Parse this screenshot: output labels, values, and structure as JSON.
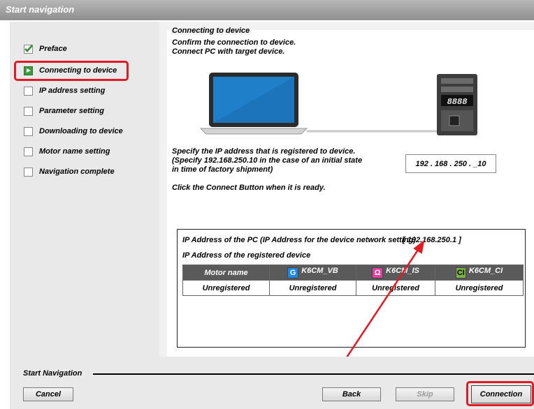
{
  "window": {
    "title": "Start navigation"
  },
  "sidebar": {
    "items": [
      {
        "label": "Preface",
        "state": "done"
      },
      {
        "label": "Connecting to device",
        "state": "current"
      },
      {
        "label": "IP address setting",
        "state": "todo"
      },
      {
        "label": "Parameter setting",
        "state": "todo"
      },
      {
        "label": "Downloading to device",
        "state": "todo"
      },
      {
        "label": "Motor name setting",
        "state": "todo"
      },
      {
        "label": "Navigation complete",
        "state": "todo"
      }
    ]
  },
  "main": {
    "group_title": "Connecting to device",
    "intro_line1": "Confirm the connection to device.",
    "intro_line2": "Connect PC with target device.",
    "device_display": "8888",
    "ip_prompt_line1": "Specify the IP address that is registered to device.",
    "ip_prompt_line2": "(Specify 192.168.250.10 in the case of an initial state",
    "ip_prompt_line3": " in time of factory shipment)",
    "ip_value": "192 . 168 . 250 . _10",
    "connect_hint": "Click the Connect Button when it is ready.",
    "info": {
      "pc_ip_label": "IP Address of the PC (IP Address for the device network setting)",
      "pc_ip_value": "[ 192.168.250.1 ]",
      "registered_label": "IP Address of the registered device",
      "columns": [
        {
          "label": "Motor name",
          "badge": "",
          "badge_color": ""
        },
        {
          "label": "K6CM_VB",
          "badge": "G",
          "badge_color": "#1e88e5"
        },
        {
          "label": "K6CM_IS",
          "badge": "Ω",
          "badge_color": "#e040a0"
        },
        {
          "label": "K6CM_CI",
          "badge": "CI",
          "badge_color": "#7cb342"
        }
      ],
      "row": [
        "Unregistered",
        "Unregistered",
        "Unregistered",
        "Unregistered"
      ]
    }
  },
  "footer": {
    "section_label": "Start Navigation",
    "cancel_label": "Cancel",
    "back_label": "Back",
    "skip_label": "Skip",
    "connection_label": "Connection"
  },
  "colors": {
    "highlight": "#e01b24",
    "title_bar": "#9e9e9e",
    "table_header": "#5a5a5a"
  }
}
